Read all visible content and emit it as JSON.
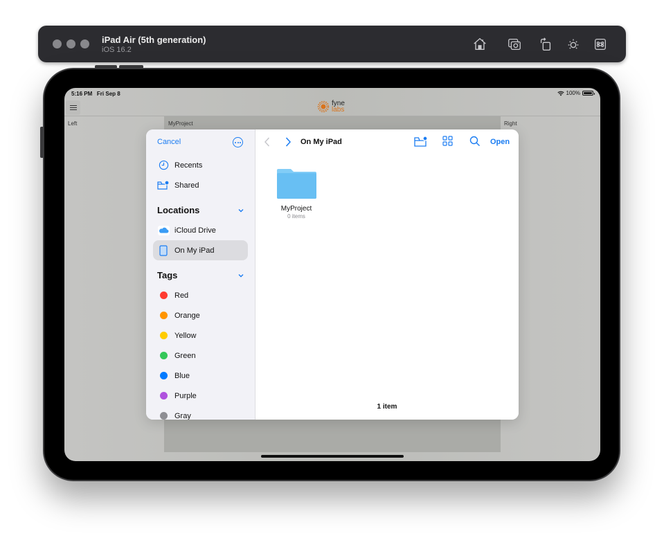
{
  "simulator": {
    "device_name": "iPad Air (5th generation)",
    "os_version": "iOS 16.2",
    "toolbar_icons": [
      "home-icon",
      "screenshot-icon",
      "rotate-icon",
      "appearance-icon",
      "keyboard-command-icon"
    ]
  },
  "status_bar": {
    "time": "5:16 PM",
    "date": "Fri Sep 8",
    "battery": "100%",
    "wifi_icon": "wifi-icon"
  },
  "app": {
    "logo_line1": "fyne",
    "logo_line2": "labs",
    "left_label": "Left",
    "center_label": "MyProject",
    "right_label": "Right",
    "brand_color": "#d9731c"
  },
  "picker": {
    "cancel_label": "Cancel",
    "favorites": [
      {
        "label": "Recents",
        "icon": "clock-icon"
      },
      {
        "label": "Shared",
        "icon": "shared-folder-icon"
      }
    ],
    "locations_title": "Locations",
    "locations": [
      {
        "label": "iCloud Drive",
        "icon": "icloud-icon",
        "selected": false
      },
      {
        "label": "On My iPad",
        "icon": "ipad-icon",
        "selected": true
      }
    ],
    "tags_title": "Tags",
    "tags": [
      {
        "label": "Red",
        "color": "#ff3b30"
      },
      {
        "label": "Orange",
        "color": "#ff9500"
      },
      {
        "label": "Yellow",
        "color": "#ffcc00"
      },
      {
        "label": "Green",
        "color": "#34c759"
      },
      {
        "label": "Blue",
        "color": "#007aff"
      },
      {
        "label": "Purple",
        "color": "#af52de"
      },
      {
        "label": "Gray",
        "color": "#8e8e93"
      }
    ],
    "current_location": "On My iPad",
    "open_label": "Open",
    "items": [
      {
        "name": "MyProject",
        "subtitle": "0 items",
        "icon": "folder-icon"
      }
    ],
    "item_count": "1 item",
    "accent_color": "#1a7cf2"
  }
}
